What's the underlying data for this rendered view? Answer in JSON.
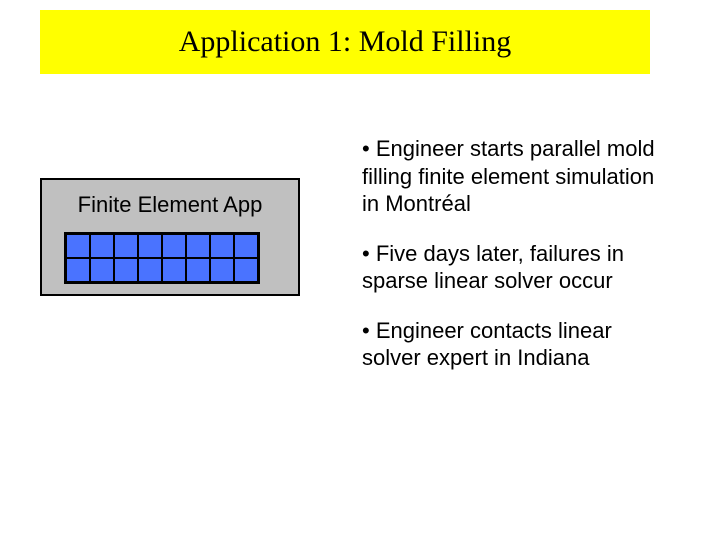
{
  "title": "Application 1: Mold Filling",
  "fe_label": "Finite Element App",
  "bullets": {
    "b1": "• Engineer starts parallel mold filling finite element simulation in Montréal",
    "b2": "• Five days later, failures in sparse linear solver occur",
    "b3": "• Engineer contacts linear solver expert in Indiana"
  },
  "grid": {
    "rows": 2,
    "cols": 8
  }
}
